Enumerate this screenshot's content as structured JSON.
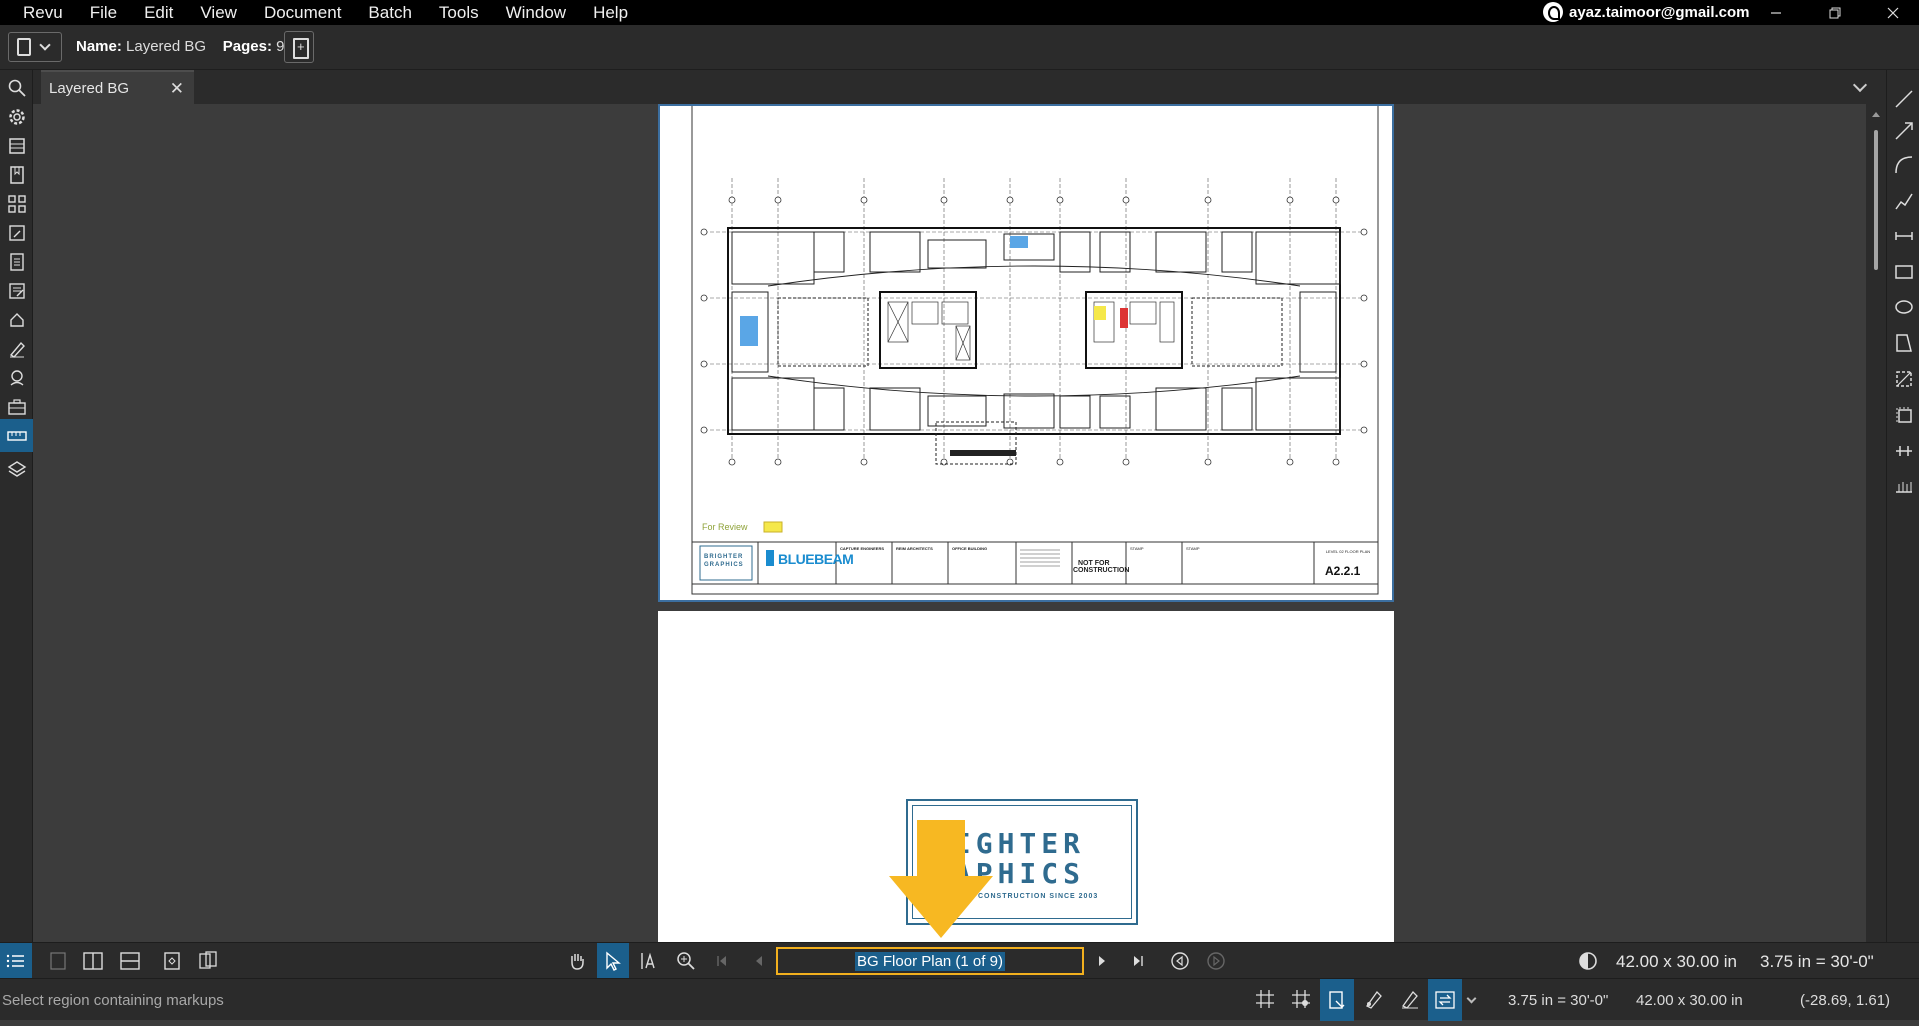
{
  "menubar": {
    "items": [
      "Revu",
      "File",
      "Edit",
      "View",
      "Document",
      "Batch",
      "Tools",
      "Window",
      "Help"
    ],
    "account": "ayaz.taimoor@gmail.com"
  },
  "toolbar": {
    "name_label": "Name:",
    "name_value": "Layered BG",
    "pages_label": "Pages:",
    "pages_value": "9"
  },
  "tabs": [
    {
      "label": "Layered BG"
    }
  ],
  "document": {
    "page1": {
      "stamp": "For Review",
      "logo_brighter": "BRIGHTER",
      "logo_graphics": "GRAPHICS",
      "bluebeam": "BLUEBEAM",
      "capture": "CAPTURE ENGINEERS",
      "reim": "REIM ARCHITECTS",
      "office": "OFFICE BUILDING",
      "not_for": "NOT FOR",
      "construction": "CONSTRUCTION",
      "stamp1": "STAMP",
      "stamp2": "STAMP",
      "sheet": "A2.2.1",
      "sheet_title": "LEVEL 02 FLOOR PLAN"
    },
    "page2": {
      "line1": "RIGHTER",
      "line2": "RAPHICS",
      "tagline": "CONSTRUCTION SINCE 2003"
    }
  },
  "bottom_toolbar": {
    "page_nav": "BG Floor Plan (1 of 9)",
    "page_size": "42.00 x 30.00 in",
    "scale": "3.75 in = 30'-0\""
  },
  "statusbar": {
    "message": "Select region containing markups",
    "scale": "3.75 in = 30'-0\"",
    "size": "42.00 x 30.00 in",
    "coords": "(-28.69, 1.61)"
  },
  "colors": {
    "accent": "#1b5f8c",
    "highlight": "#f2b01e",
    "bluebeam": "#1a8ccf"
  }
}
